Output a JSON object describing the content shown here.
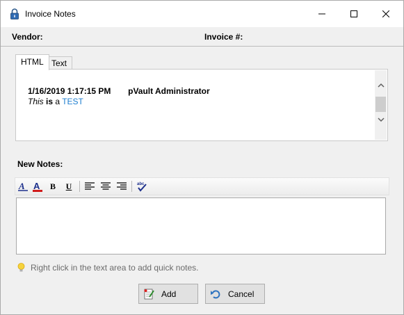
{
  "window": {
    "title": "Invoice Notes",
    "icon": "padlock-icon",
    "controls": [
      "minimize-icon",
      "maximize-icon",
      "close-icon"
    ]
  },
  "header": {
    "vendor_label": "Vendor:",
    "invoice_label": "Invoice #:"
  },
  "tabs": [
    {
      "label": "HTML",
      "active": true
    },
    {
      "label": "Text",
      "active": false
    }
  ],
  "notes": {
    "entries": [
      {
        "timestamp": "1/16/2019 1:17:15 PM",
        "author": "pVault Administrator",
        "body": {
          "italic": "This",
          "bold": "is",
          "plain": "a",
          "link": "TEST"
        }
      }
    ]
  },
  "new_notes": {
    "label": "New Notes:",
    "toolbar": {
      "font_button_icon": "font-style-icon",
      "color_button_icon": "font-color-icon",
      "bold_label": "B",
      "underline_label": "U",
      "align_left_icon": "align-left-icon",
      "align_center_icon": "align-center-icon",
      "align_right_icon": "align-right-icon",
      "spellcheck_icon": "spellcheck-icon"
    },
    "value": ""
  },
  "tip": {
    "icon": "lightbulb-icon",
    "text": "Right click in the text area to add quick notes."
  },
  "buttons": {
    "add": "Add",
    "cancel": "Cancel"
  },
  "colors": {
    "link": "#1f7fd0",
    "font_color_underline": "#d01c1c",
    "titlebar_bg": "#ffffff",
    "dialog_bg": "#f0f0f0"
  }
}
